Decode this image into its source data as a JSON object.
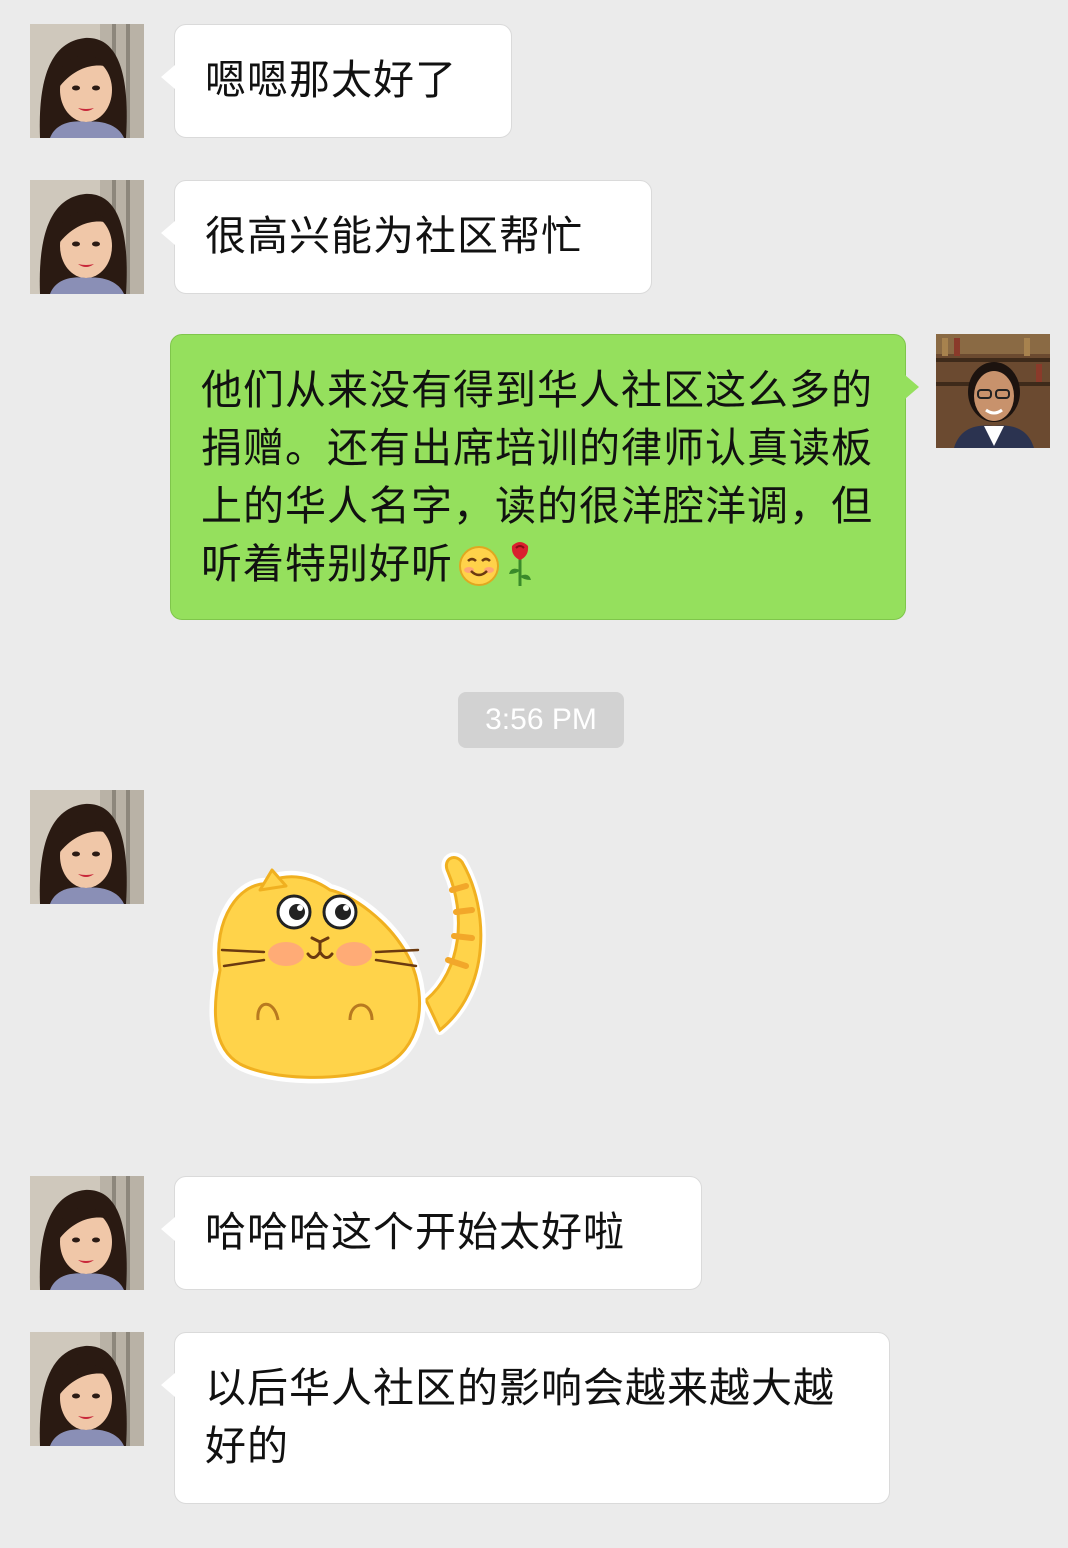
{
  "messages": [
    {
      "sender": "contact",
      "text": "嗯嗯那太好了"
    },
    {
      "sender": "contact",
      "text": "很高兴能为社区帮忙"
    },
    {
      "sender": "me",
      "text": "他们从来没有得到华人社区这么多的捐赠。还有出席培训的律师认真读板上的华人名字，读的很洋腔洋调，但听着特别好听",
      "emoji": [
        "smiling-face-icon",
        "rose-icon"
      ]
    },
    {
      "sender": "contact",
      "type": "sticker",
      "sticker": "yellow-cat-sticker"
    },
    {
      "sender": "contact",
      "text": "哈哈哈这个开始太好啦"
    },
    {
      "sender": "contact",
      "text": "以后华人社区的影响会越来越大越好的"
    }
  ],
  "timestamp": "3:56 PM",
  "colors": {
    "background": "#ebebeb",
    "incoming_bubble": "#ffffff",
    "outgoing_bubble": "#95e05d",
    "timestamp_pill": "#d2d2d2"
  }
}
